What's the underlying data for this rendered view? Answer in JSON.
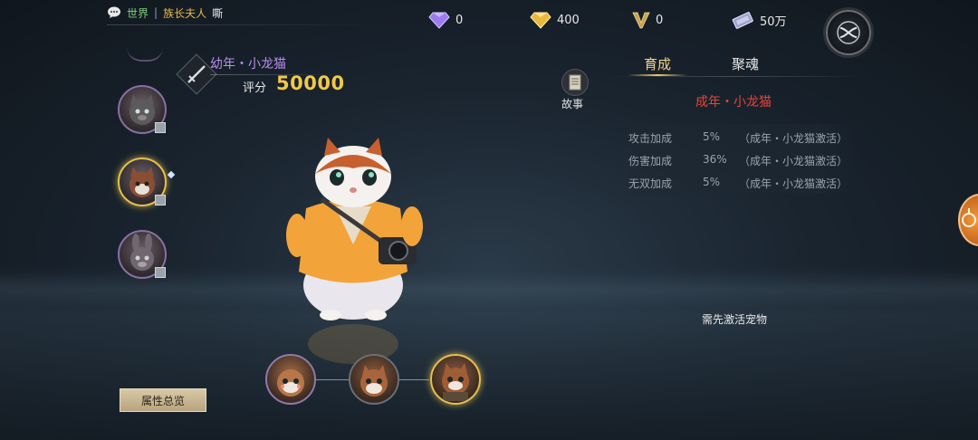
{
  "chat": {
    "channel": "世界",
    "separator": "|",
    "sender": "族长夫人",
    "message": "嘶"
  },
  "currencies": [
    {
      "icon": "purple-diamond-icon",
      "value": "0"
    },
    {
      "icon": "gold-diamond-icon",
      "value": "400"
    },
    {
      "icon": "v-badge-icon",
      "value": "0"
    },
    {
      "icon": "silver-ticket-icon",
      "value": "50万"
    }
  ],
  "pet": {
    "name": "幼年・小龙猫",
    "score_label": "评分",
    "score": "50000"
  },
  "story_button": {
    "label": "故事"
  },
  "tabs": [
    {
      "label": "育成",
      "active": true
    },
    {
      "label": "聚魂",
      "active": false
    }
  ],
  "stage_title": "成年・小龙猫",
  "attributes": [
    {
      "name": "攻击加成",
      "value": "5%",
      "condition": "（成年・小龙猫激活）"
    },
    {
      "name": "伤害加成",
      "value": "36%",
      "condition": "（成年・小龙猫激活）"
    },
    {
      "name": "无双加成",
      "value": "5%",
      "condition": "（成年・小龙猫激活）"
    }
  ],
  "need_activate": "需先激活宠物",
  "summary_button": "属性总览",
  "colors": {
    "gold": "#f0c84a",
    "purple": "#b98df0",
    "red": "#e5453a",
    "green": "#7fd07a"
  }
}
